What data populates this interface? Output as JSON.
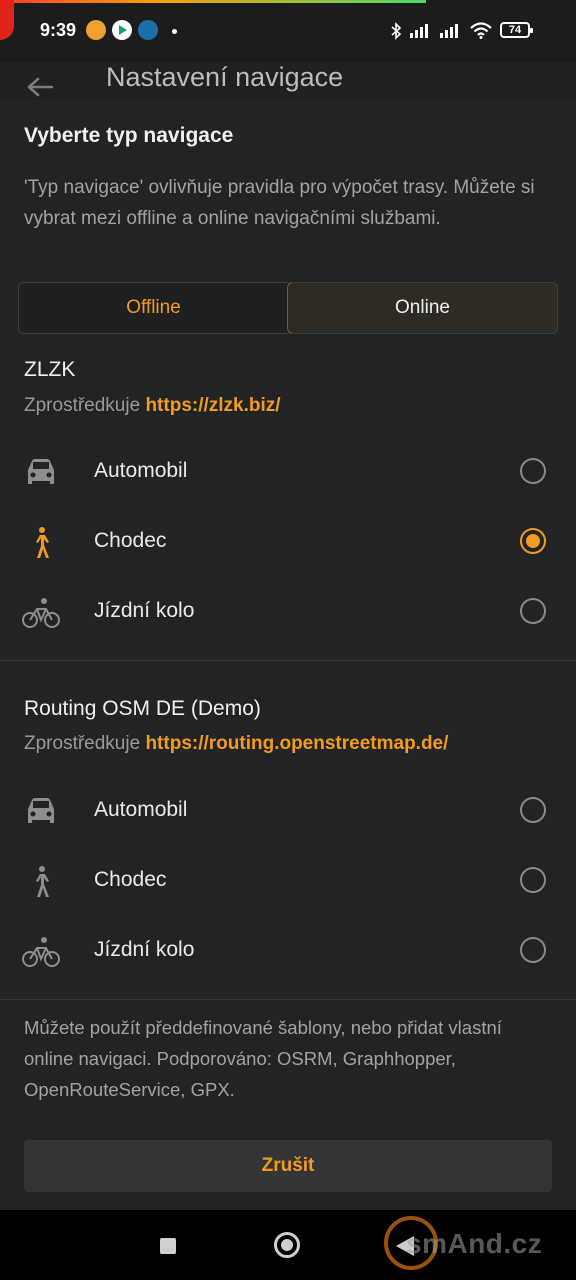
{
  "status": {
    "time": "9:39",
    "battery": "74"
  },
  "appbar": {
    "title": "Nastavení navigace"
  },
  "nav_type": {
    "heading": "Vyberte typ navigace",
    "description": "'Typ navigace' ovlivňuje pravidla pro výpočet trasy. Můžete si vybrat mezi offline a online navigačními službami.",
    "tabs": [
      {
        "label": "Offline",
        "selected": false
      },
      {
        "label": "Online",
        "selected": true
      }
    ]
  },
  "providers": [
    {
      "name": "ZLZK",
      "by_prefix": "Zprostředkuje",
      "url": "https://zlzk.biz/",
      "options": [
        {
          "label": "Automobil",
          "icon": "car-icon",
          "selected": false
        },
        {
          "label": "Chodec",
          "icon": "pedestrian-icon",
          "selected": true
        },
        {
          "label": "Jízdní kolo",
          "icon": "bicycle-icon",
          "selected": false
        }
      ]
    },
    {
      "name": "Routing OSM DE (Demo)",
      "by_prefix": "Zprostředkuje",
      "url": "https://routing.openstreetmap.de/",
      "options": [
        {
          "label": "Automobil",
          "icon": "car-icon",
          "selected": false
        },
        {
          "label": "Chodec",
          "icon": "pedestrian-icon",
          "selected": false
        },
        {
          "label": "Jízdní kolo",
          "icon": "bicycle-icon",
          "selected": false
        }
      ]
    }
  ],
  "footer": {
    "text": "Můžete použít předdefinované šablony, nebo přidat vlastní online navigaci. Podporováno: OSRM, Graphhopper, OpenRouteService, GPX."
  },
  "cancel_label": "Zrušit",
  "watermark": "smAnd.cz",
  "colors": {
    "accent": "#f29b21",
    "background": "#222324"
  }
}
